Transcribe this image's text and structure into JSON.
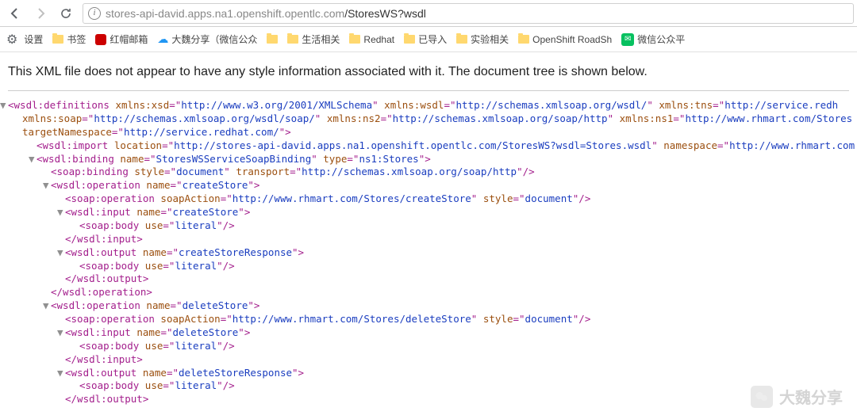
{
  "navbar": {
    "url_prefix": "stores-api-david.apps.na1.openshift.opentlc.com",
    "url_path": "/StoresWS?wsdl"
  },
  "bookmarks": {
    "settings": "设置",
    "items": [
      {
        "label": "书签",
        "icon": "folder"
      },
      {
        "label": "红帽邮箱",
        "icon": "redhat"
      },
      {
        "label": "大魏分享（微信公众",
        "icon": "cloud"
      },
      {
        "label": "",
        "icon": "folder"
      },
      {
        "label": "生活相关",
        "icon": "folder"
      },
      {
        "label": "Redhat",
        "icon": "folder"
      },
      {
        "label": "已导入",
        "icon": "folder"
      },
      {
        "label": "实验相关",
        "icon": "folder"
      },
      {
        "label": "OpenShift RoadSh",
        "icon": "folder"
      },
      {
        "label": "微信公众平",
        "icon": "wechat"
      }
    ]
  },
  "notice": "This XML file does not appear to have any style information associated with it. The document tree is shown below.",
  "xml": {
    "definitions": {
      "tag": "wsdl:definitions",
      "attrs": [
        {
          "n": "xmlns:xsd",
          "v": "http://www.w3.org/2001/XMLSchema"
        },
        {
          "n": "xmlns:wsdl",
          "v": "http://schemas.xmlsoap.org/wsdl/"
        },
        {
          "n": "xmlns:tns",
          "v": "http://service.redh"
        },
        {
          "n": "xmlns:soap",
          "v": "http://schemas.xmlsoap.org/wsdl/soap/"
        },
        {
          "n": "xmlns:ns2",
          "v": "http://schemas.xmlsoap.org/soap/http"
        },
        {
          "n": "xmlns:ns1",
          "v": "http://www.rhmart.com/Stores"
        },
        {
          "n": "targetNamespace",
          "v": "http://service.redhat.com/"
        }
      ]
    },
    "import": {
      "tag": "wsdl:import",
      "location": "http://stores-api-david.apps.na1.openshift.opentlc.com/StoresWS?wsdl=Stores.wsdl",
      "namespace": "http://www.rhmart.com"
    },
    "binding": {
      "tag": "wsdl:binding",
      "name": "StoresWSServiceSoapBinding",
      "type": "ns1:Stores"
    },
    "soapBinding": {
      "tag": "soap:binding",
      "style": "document",
      "transport": "http://schemas.xmlsoap.org/soap/http"
    },
    "op1": {
      "tag": "wsdl:operation",
      "name": "createStore",
      "soapAction": "http://www.rhmart.com/Stores/createStore",
      "style": "document",
      "inputName": "createStore",
      "outputName": "createStoreResponse",
      "use": "literal"
    },
    "op2": {
      "tag": "wsdl:operation",
      "name": "deleteStore",
      "soapAction": "http://www.rhmart.com/Stores/deleteStore",
      "style": "document",
      "inputName": "deleteStore",
      "outputName": "deleteStoreResponse",
      "use": "literal"
    },
    "soapOperation": "soap:operation",
    "input": "wsdl:input",
    "output": "wsdl:output",
    "soapBody": "soap:body",
    "closeInput": "</wsdl:input>",
    "closeOutput": "</wsdl:output>",
    "closeOperation": "</wsdl:operation>",
    "attrNames": {
      "name": "name",
      "type": "type",
      "style": "style",
      "transport": "transport",
      "soapAction": "soapAction",
      "use": "use",
      "location": "location",
      "namespace": "namespace"
    }
  },
  "watermark": "大魏分享"
}
